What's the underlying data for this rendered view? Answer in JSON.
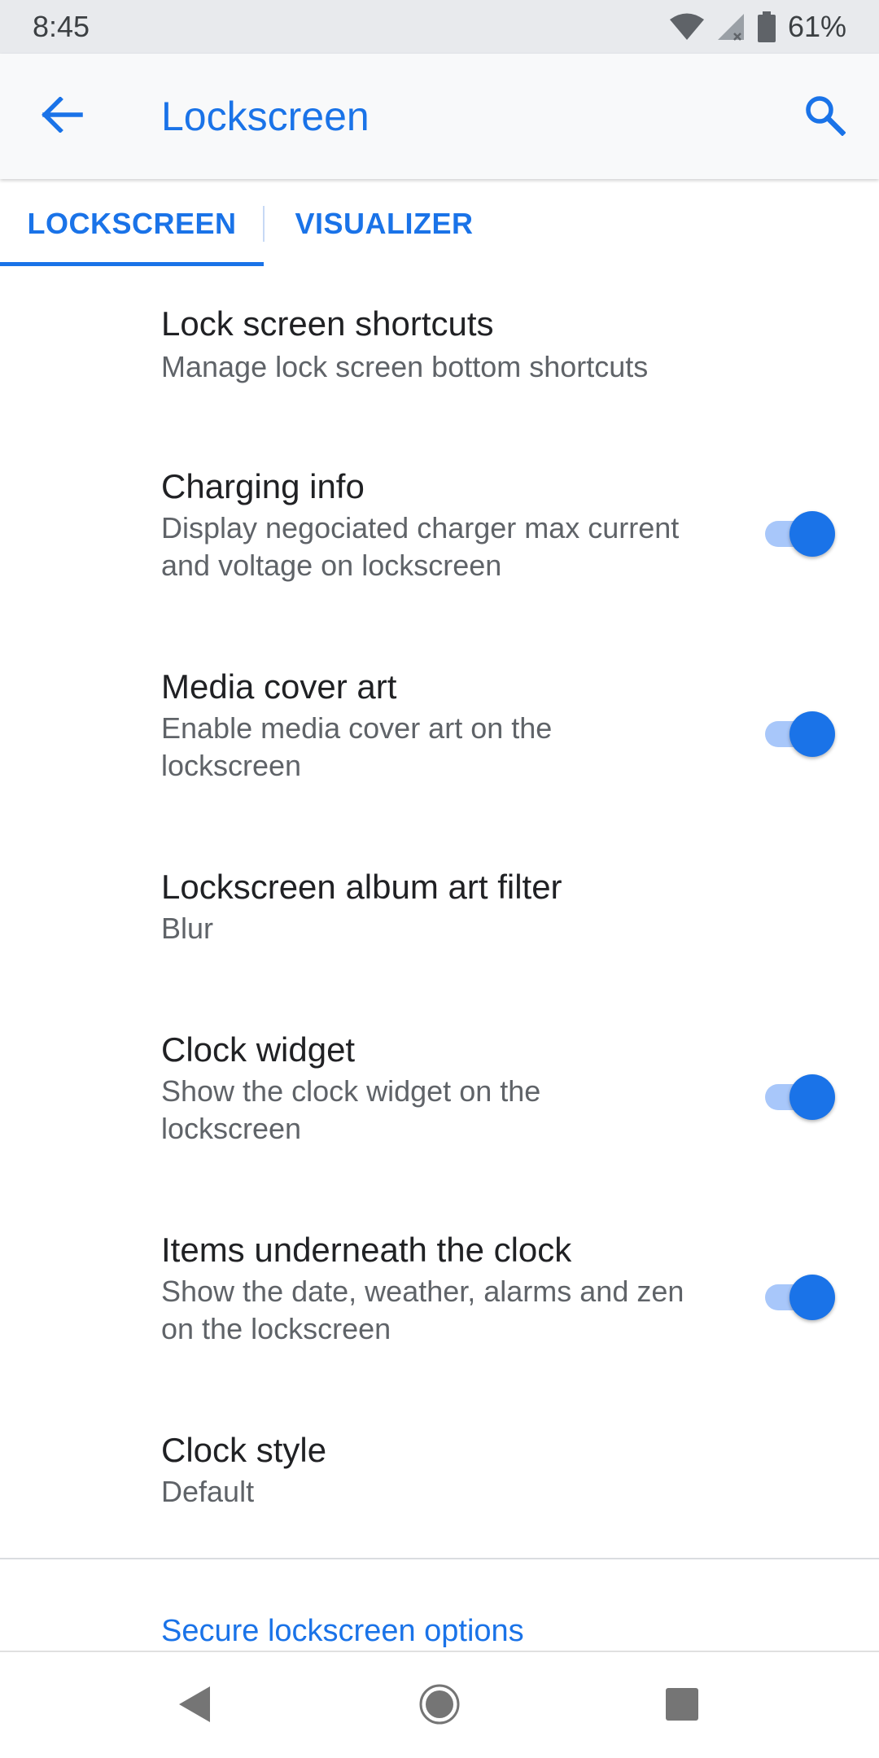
{
  "status_bar": {
    "time": "8:45",
    "battery_percent": "61%",
    "icons": [
      "wifi-icon",
      "signal-icon",
      "battery-icon"
    ]
  },
  "app_bar": {
    "title": "Lockscreen",
    "back_icon": "arrow-back-icon",
    "search_icon": "search-icon"
  },
  "tabs": [
    {
      "label": "LOCKSCREEN",
      "selected": true
    },
    {
      "label": "VISUALIZER",
      "selected": false
    }
  ],
  "preferences": [
    {
      "title": "Lock screen shortcuts",
      "summary": "Manage lock screen bottom shortcuts"
    },
    {
      "title": "Charging info",
      "summary": "Display negociated charger max current and voltage on lockscreen",
      "toggle": true
    },
    {
      "title": "Media cover art",
      "summary": "Enable media cover art on the lockscreen",
      "toggle": true
    },
    {
      "title": "Lockscreen album art filter",
      "summary": "Blur"
    },
    {
      "title": "Clock widget",
      "summary": "Show the clock widget on the lockscreen",
      "toggle": true
    },
    {
      "title": "Items underneath the clock",
      "summary": "Show the date, weather, alarms and zen on the lockscreen",
      "toggle": true
    },
    {
      "title": "Clock style",
      "summary": "Default"
    }
  ],
  "secure_options": {
    "label": "Secure lockscreen options"
  },
  "nav_bar": {
    "icons": [
      "nav-back-icon",
      "nav-home-icon",
      "nav-recents-icon"
    ]
  },
  "colors": {
    "accent": "#1a73e8",
    "track": "#a8c7fa",
    "status_bar": "#e8eaed",
    "app_bar": "#f8f9fa"
  }
}
